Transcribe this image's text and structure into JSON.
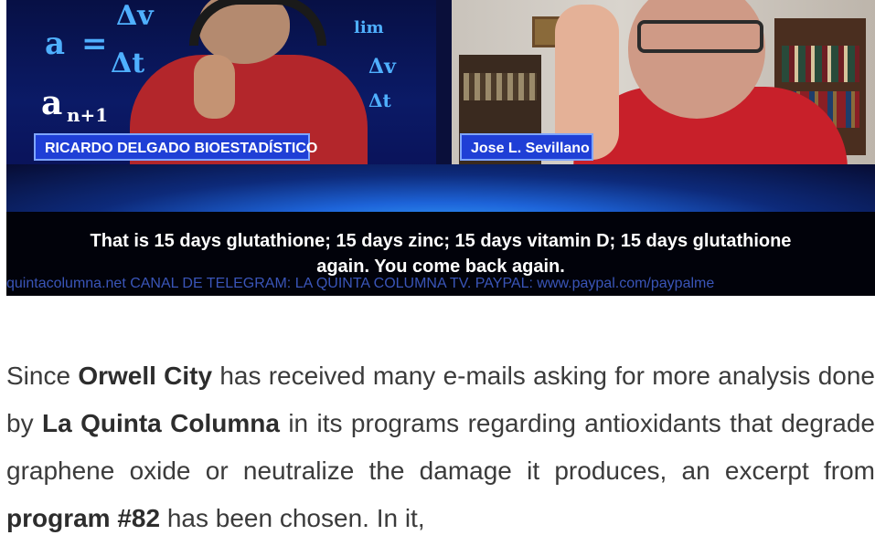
{
  "video": {
    "name_left": "RICARDO DELGADO BIOESTADÍSTICO",
    "name_right": "Jose L. Sevillano",
    "subtitle_line1": "That is 15 days glutathione; 15 days zinc; 15 days vitamin D; 15 days glutathione",
    "subtitle_line2": "again. You come back again.",
    "ticker": "quintacolumna.net CANAL DE TELEGRAM: LA QUINTA COLUMNA TV. PAYPAL: www.paypal.com/paypalme",
    "math": {
      "a": "a",
      "eq": "=",
      "dv": "Δv",
      "dt": "Δt",
      "an1": "a",
      "sub": "n+1",
      "lim": "lim",
      "dv2": "Δv",
      "dt2": "Δt"
    }
  },
  "article": {
    "p1": "Since ",
    "b1": "Orwell City",
    "p2": " has received many e-mails asking for more analysis done by ",
    "b2": "La Quinta Columna",
    "p3": " in its programs regarding antioxidants that degrade graphene oxide or neutralize the damage it produces, an excerpt from ",
    "b3": "program #82",
    "p4": " has been chosen. In it,"
  },
  "colors": {
    "tag_bg": "#1f3fd6",
    "shirt_red": "#c8202a",
    "text": "#3b3b3b"
  }
}
